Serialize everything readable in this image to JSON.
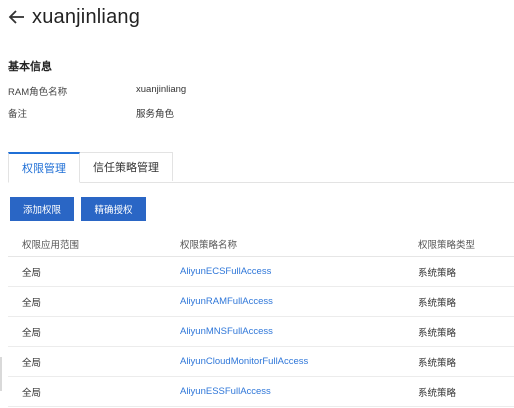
{
  "header": {
    "title": "xuanjinliang"
  },
  "basic_info": {
    "section_title": "基本信息",
    "role_name_label": "RAM角色名称",
    "role_name_value": "xuanjinliang",
    "note_label": "备注",
    "note_value": "服务角色"
  },
  "tabs": [
    {
      "label": "权限管理",
      "active": true
    },
    {
      "label": "信任策略管理",
      "active": false
    }
  ],
  "actions": {
    "add_permission": "添加权限",
    "precise_grant": "精确授权"
  },
  "table": {
    "columns": [
      "权限应用范围",
      "权限策略名称",
      "权限策略类型"
    ],
    "rows": [
      {
        "scope": "全局",
        "policy": "AliyunECSFullAccess",
        "type": "系统策略"
      },
      {
        "scope": "全局",
        "policy": "AliyunRAMFullAccess",
        "type": "系统策略"
      },
      {
        "scope": "全局",
        "policy": "AliyunMNSFullAccess",
        "type": "系统策略"
      },
      {
        "scope": "全局",
        "policy": "AliyunCloudMonitorFullAccess",
        "type": "系统策略"
      },
      {
        "scope": "全局",
        "policy": "AliyunESSFullAccess",
        "type": "系统策略"
      }
    ]
  },
  "colors": {
    "accent": "#2a66c5",
    "link": "#2f77d9",
    "tab_active": "#1f6fd6"
  },
  "icons": {
    "back": "arrow-left-icon"
  }
}
